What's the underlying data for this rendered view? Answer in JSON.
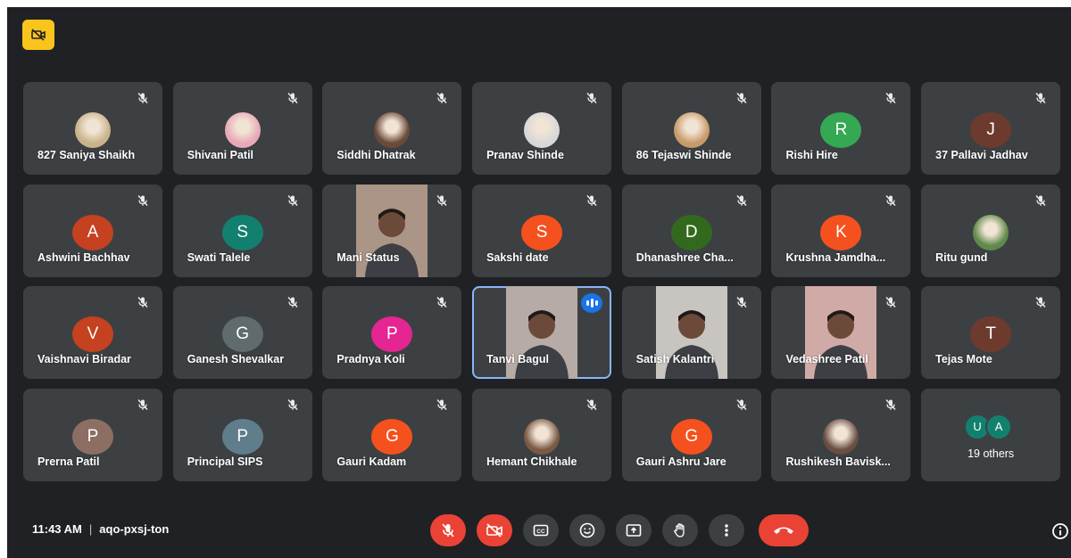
{
  "meeting": {
    "time": "11:43 AM",
    "separator": "|",
    "code": "aqo-pxsj-ton",
    "recording_badge_icon": "camera-off-icon"
  },
  "participants": [
    {
      "name": "827 Saniya Shaikh",
      "kind": "photo",
      "photo_color": "#c9b38a",
      "muted": true
    },
    {
      "name": "Shivani Patil",
      "kind": "photo",
      "photo_color": "#e8a9b8",
      "muted": true
    },
    {
      "name": "Siddhi Dhatrak",
      "kind": "photo",
      "photo_color": "#6b4a3a",
      "muted": true
    },
    {
      "name": "Pranav Shinde",
      "kind": "photo",
      "photo_color": "#d8d8d8",
      "muted": true
    },
    {
      "name": "86 Tejaswi Shinde",
      "kind": "photo",
      "photo_color": "#c89b6a",
      "muted": true
    },
    {
      "name": "Rishi Hire",
      "kind": "initial",
      "initial": "R",
      "color": "#34a853",
      "muted": true
    },
    {
      "name": "37 Pallavi Jadhav",
      "kind": "initial",
      "initial": "J",
      "color": "#6d3b2e",
      "muted": true
    },
    {
      "name": "Ashwini Bachhav",
      "kind": "initial",
      "initial": "A",
      "color": "#c5411f",
      "muted": true
    },
    {
      "name": "Swati Talele",
      "kind": "initial",
      "initial": "S",
      "color": "#12806f",
      "muted": true
    },
    {
      "name": "Mani Status",
      "kind": "video",
      "video_color": "#8a6a55",
      "muted": true
    },
    {
      "name": "Sakshi date",
      "kind": "initial",
      "initial": "S",
      "color": "#f4511e",
      "muted": true
    },
    {
      "name": "Dhanashree Cha...",
      "kind": "initial",
      "initial": "D",
      "color": "#33691e",
      "muted": true
    },
    {
      "name": "Krushna Jamdha...",
      "kind": "initial",
      "initial": "K",
      "color": "#f4511e",
      "muted": true
    },
    {
      "name": "Ritu gund",
      "kind": "photo",
      "photo_color": "#5f8a4a",
      "muted": true
    },
    {
      "name": "Vaishnavi Biradar",
      "kind": "initial",
      "initial": "V",
      "color": "#c5411f",
      "muted": true
    },
    {
      "name": "Ganesh Shevalkar",
      "kind": "initial",
      "initial": "G",
      "color": "#5f6b6d",
      "muted": true
    },
    {
      "name": "Pradnya Koli",
      "kind": "initial",
      "initial": "P",
      "color": "#e52592",
      "muted": true
    },
    {
      "name": "Tanvi Bagul",
      "kind": "video",
      "video_color": "#9c8d86",
      "muted": false,
      "speaking": true
    },
    {
      "name": "Satish Kalantri",
      "kind": "video",
      "video_color": "#b7b4ae",
      "muted": true
    },
    {
      "name": "Vedashree Patil",
      "kind": "video",
      "video_color": "#c48a86",
      "muted": true
    },
    {
      "name": "Tejas Mote",
      "kind": "initial",
      "initial": "T",
      "color": "#6d3b2e",
      "muted": true
    },
    {
      "name": "Prerna Patil",
      "kind": "initial",
      "initial": "P",
      "color": "#8d6e63",
      "muted": true
    },
    {
      "name": "Principal SIPS",
      "kind": "initial",
      "initial": "P",
      "color": "#607d8b",
      "muted": true
    },
    {
      "name": "Gauri Kadam",
      "kind": "initial",
      "initial": "G",
      "color": "#f4511e",
      "muted": true
    },
    {
      "name": "Hemant Chikhale",
      "kind": "photo",
      "photo_color": "#7a5a44",
      "muted": true
    },
    {
      "name": "Gauri Ashru Jare",
      "kind": "initial",
      "initial": "G",
      "color": "#f4511e",
      "muted": true
    },
    {
      "name": "Rushikesh Bavisk...",
      "kind": "photo",
      "photo_color": "#6a4e42",
      "muted": true
    }
  ],
  "others": {
    "label": "19 others",
    "avatars": [
      {
        "initial": "U",
        "color": "#12806f"
      },
      {
        "initial": "A",
        "color": "#12806f"
      }
    ]
  },
  "controls": [
    {
      "name": "mic-off-icon",
      "style": "red"
    },
    {
      "name": "camera-off-icon",
      "style": "red"
    },
    {
      "name": "captions-icon",
      "style": "dark"
    },
    {
      "name": "emoji-icon",
      "style": "dark"
    },
    {
      "name": "present-icon",
      "style": "dark"
    },
    {
      "name": "raise-hand-icon",
      "style": "dark"
    },
    {
      "name": "more-options-icon",
      "style": "dark"
    },
    {
      "name": "hangup-icon",
      "style": "hangup"
    }
  ],
  "info_icon": "info-icon"
}
